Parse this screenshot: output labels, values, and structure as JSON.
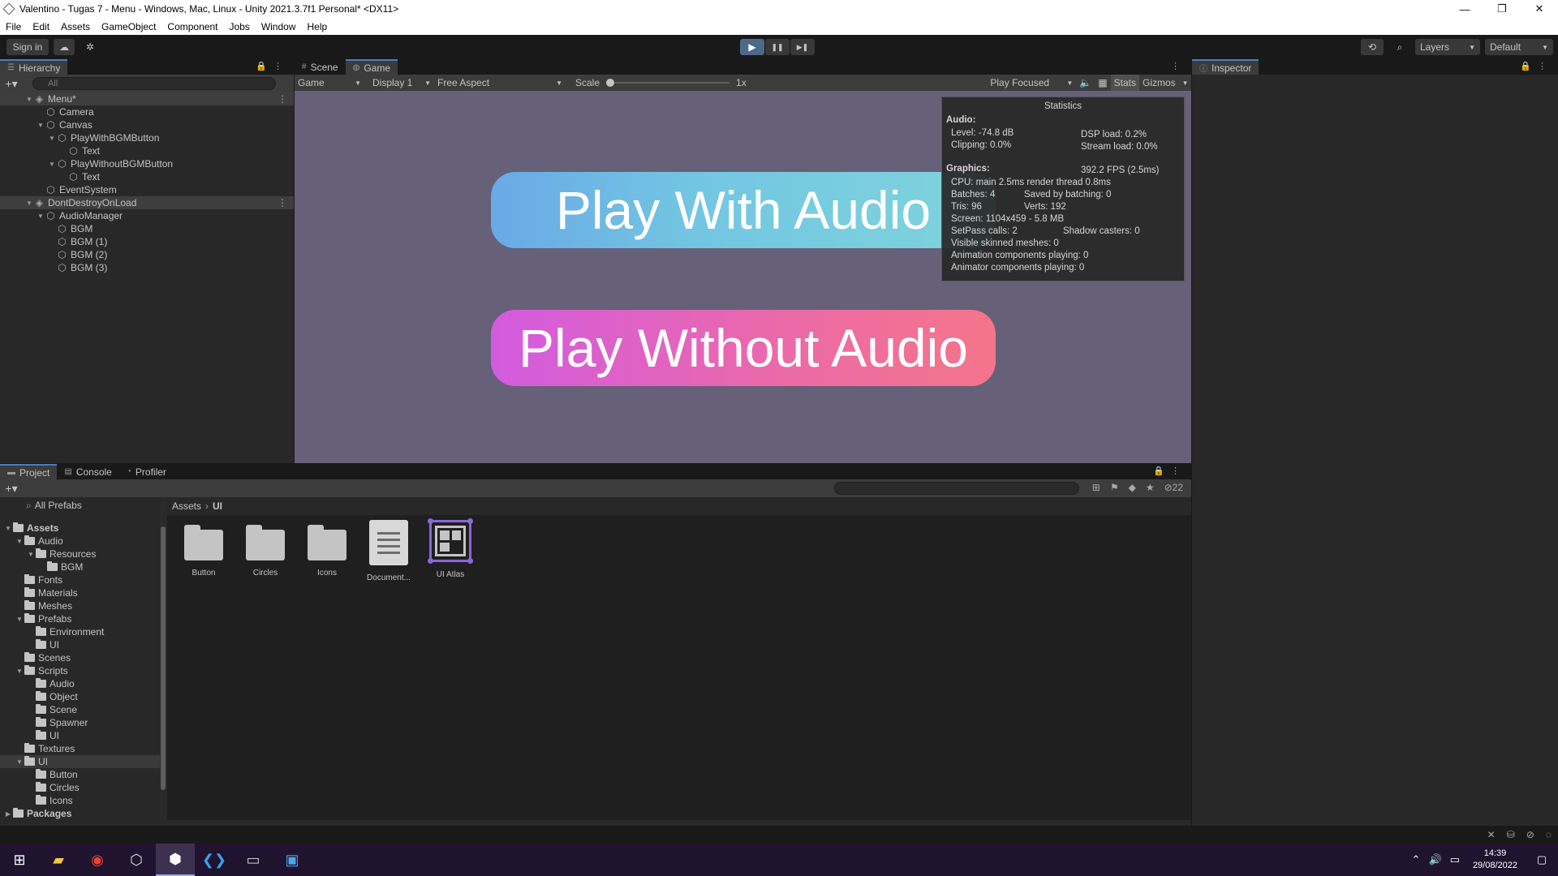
{
  "window": {
    "title": "Valentino - Tugas 7 - Menu - Windows, Mac, Linux - Unity 2021.3.7f1 Personal* <DX11>",
    "min_glyph": "—",
    "max_glyph": "❐",
    "close_glyph": "✕"
  },
  "menu": [
    "File",
    "Edit",
    "Assets",
    "GameObject",
    "Component",
    "Jobs",
    "Window",
    "Help"
  ],
  "toolbar": {
    "sign_in": "Sign in",
    "play_glyph": "▶",
    "pause_glyph": "❚❚",
    "step_glyph": "▶❚",
    "layers": "Layers",
    "layout": "Default"
  },
  "hierarchy": {
    "tab": "Hierarchy",
    "search_placeholder": "All",
    "rows": [
      {
        "label": "Menu*",
        "indent": 0,
        "scene": true,
        "arrow": "▼"
      },
      {
        "label": "Camera",
        "indent": 1,
        "arrow": ""
      },
      {
        "label": "Canvas",
        "indent": 1,
        "arrow": "▼"
      },
      {
        "label": "PlayWithBGMButton",
        "indent": 2,
        "arrow": "▼"
      },
      {
        "label": "Text",
        "indent": 3,
        "arrow": ""
      },
      {
        "label": "PlayWithoutBGMButton",
        "indent": 2,
        "arrow": "▼"
      },
      {
        "label": "Text",
        "indent": 3,
        "arrow": ""
      },
      {
        "label": "EventSystem",
        "indent": 1,
        "arrow": ""
      },
      {
        "label": "DontDestroyOnLoad",
        "indent": 0,
        "scene": true,
        "arrow": "▼"
      },
      {
        "label": "AudioManager",
        "indent": 1,
        "arrow": "▼"
      },
      {
        "label": "BGM",
        "indent": 2,
        "arrow": ""
      },
      {
        "label": "BGM (1)",
        "indent": 2,
        "arrow": ""
      },
      {
        "label": "BGM (2)",
        "indent": 2,
        "arrow": ""
      },
      {
        "label": "BGM (3)",
        "indent": 2,
        "arrow": ""
      }
    ]
  },
  "game": {
    "tabs": [
      "Scene",
      "Game"
    ],
    "view_select": "Game",
    "display_select": "Display 1",
    "aspect_select": "Free Aspect",
    "scale_label": "Scale",
    "scale_value": "1x",
    "play_mode": "Play Focused",
    "stats_label": "Stats",
    "gizmos_label": "Gizmos",
    "button_with_audio": "Play With Audio",
    "button_without_audio": "Play Without Audio",
    "accent_blue": "#6aa9e6",
    "accent_pink": "#e860b8",
    "background": "#666079"
  },
  "stats": {
    "title": "Statistics",
    "audio_header": "Audio:",
    "level": "Level: -74.8 dB",
    "dsp_load": "DSP load: 0.2%",
    "clipping": "Clipping: 0.0%",
    "stream_load": "Stream load: 0.0%",
    "graphics_header": "Graphics:",
    "fps": "392.2 FPS (2.5ms)",
    "cpu": "CPU: main 2.5ms  render thread 0.8ms",
    "batches": "Batches: 4",
    "saved_batching": "Saved by batching: 0",
    "tris": "Tris: 96",
    "verts": "Verts: 192",
    "screen": "Screen: 1104x459 - 5.8 MB",
    "setpass": "SetPass calls: 2",
    "shadow_casters": "Shadow casters: 0",
    "skinned": "Visible skinned meshes: 0",
    "animation": "Animation components playing: 0",
    "animator": "Animator components playing: 0"
  },
  "inspector": {
    "tab": "Inspector"
  },
  "project": {
    "tabs": [
      "Project",
      "Console",
      "Profiler"
    ],
    "hidden_count": "22",
    "favorites": "All Prefabs",
    "tree": [
      {
        "label": "Assets",
        "indent": 0,
        "arrow": "▼",
        "bold": true
      },
      {
        "label": "Audio",
        "indent": 1,
        "arrow": "▼"
      },
      {
        "label": "Resources",
        "indent": 2,
        "arrow": "▼"
      },
      {
        "label": "BGM",
        "indent": 3,
        "arrow": ""
      },
      {
        "label": "Fonts",
        "indent": 1,
        "arrow": ""
      },
      {
        "label": "Materials",
        "indent": 1,
        "arrow": ""
      },
      {
        "label": "Meshes",
        "indent": 1,
        "arrow": ""
      },
      {
        "label": "Prefabs",
        "indent": 1,
        "arrow": "▼"
      },
      {
        "label": "Environment",
        "indent": 2,
        "arrow": ""
      },
      {
        "label": "UI",
        "indent": 2,
        "arrow": ""
      },
      {
        "label": "Scenes",
        "indent": 1,
        "arrow": ""
      },
      {
        "label": "Scripts",
        "indent": 1,
        "arrow": "▼"
      },
      {
        "label": "Audio",
        "indent": 2,
        "arrow": ""
      },
      {
        "label": "Object",
        "indent": 2,
        "arrow": ""
      },
      {
        "label": "Scene",
        "indent": 2,
        "arrow": ""
      },
      {
        "label": "Spawner",
        "indent": 2,
        "arrow": ""
      },
      {
        "label": "UI",
        "indent": 2,
        "arrow": ""
      },
      {
        "label": "Textures",
        "indent": 1,
        "arrow": ""
      },
      {
        "label": "UI",
        "indent": 1,
        "arrow": "▼",
        "selected": true
      },
      {
        "label": "Button",
        "indent": 2,
        "arrow": ""
      },
      {
        "label": "Circles",
        "indent": 2,
        "arrow": ""
      },
      {
        "label": "Icons",
        "indent": 2,
        "arrow": ""
      },
      {
        "label": "Packages",
        "indent": 0,
        "arrow": "▶",
        "bold": true
      }
    ],
    "breadcrumb": [
      "Assets",
      "UI"
    ],
    "assets": [
      {
        "label": "Button",
        "kind": "folder"
      },
      {
        "label": "Circles",
        "kind": "folder"
      },
      {
        "label": "Icons",
        "kind": "folder"
      },
      {
        "label": "Document...",
        "kind": "doc"
      },
      {
        "label": "UI Atlas",
        "kind": "atlas"
      }
    ]
  },
  "taskbar": {
    "time": "14:39",
    "date": "29/08/2022",
    "apps": [
      "windows-start",
      "file-explorer",
      "chrome",
      "unity-hub",
      "unity-editor",
      "vs-code",
      "terminal",
      "photos"
    ]
  }
}
